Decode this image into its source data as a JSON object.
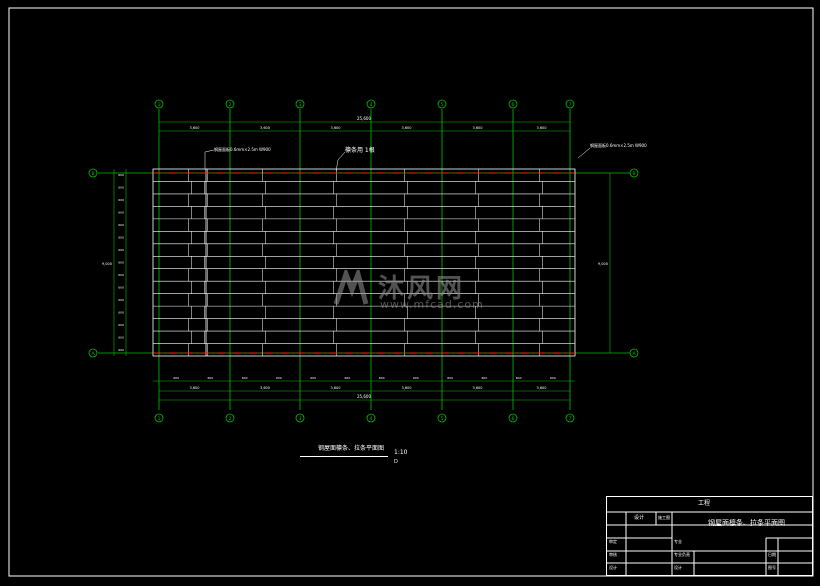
{
  "drawing": {
    "grid_numbers": [
      "1",
      "2",
      "3",
      "4",
      "5",
      "6",
      "7"
    ],
    "row_labels": [
      "B",
      "A"
    ],
    "top_total_dim": "25,600",
    "top_segment_dims": [
      "3,600",
      "3,600",
      "3,600",
      "3,600",
      "3,600",
      "3,600"
    ],
    "bottom_subtotal_dims": [
      "3,600",
      "3,600",
      "3,600",
      "3,600",
      "3,600",
      "3,600"
    ],
    "bottom_total_dim": "25,600",
    "bottom_fine_dims": [
      "600",
      "600",
      "600",
      "600",
      "600",
      "600",
      "600",
      "600",
      "600",
      "600",
      "600",
      "600"
    ],
    "left_span_dim": "9,000",
    "right_span_dim": "9,000",
    "left_row_dims": [
      "600",
      "600",
      "600",
      "600",
      "600",
      "600",
      "600",
      "600",
      "600",
      "600",
      "600",
      "600",
      "600",
      "600",
      "600"
    ],
    "annotation_left": "钢屋面板0.6mm×2.5m W900",
    "annotation_center": "檩条用 1根",
    "annotation_right": "钢屋面板0.6mm×2.5m W900",
    "plan_title": "钢屋面檩条、拉条平面图",
    "plan_scale": "1:10",
    "plan_sub": "D"
  },
  "title_block": {
    "header": "工程",
    "design_org": "设计",
    "phase": "施工图",
    "drawing_name": "钢屋面檩条、拉条平面图",
    "rows": [
      {
        "left": "审定",
        "right": "专业"
      },
      {
        "left": "审核",
        "right": "专业负责"
      },
      {
        "left": "设计",
        "right": "设计"
      }
    ],
    "sheet_label": "图号",
    "date_label": "日期"
  },
  "watermark": {
    "brand_cn": "沐风网",
    "brand_en": "www.mfcad.com"
  },
  "colors": {
    "background": "#000000",
    "grid_line": "#00c000",
    "axis_dash": "#ff2020",
    "purlin": "#ffffff",
    "dim_text": "#ffffff",
    "frame": "#ffffff"
  }
}
